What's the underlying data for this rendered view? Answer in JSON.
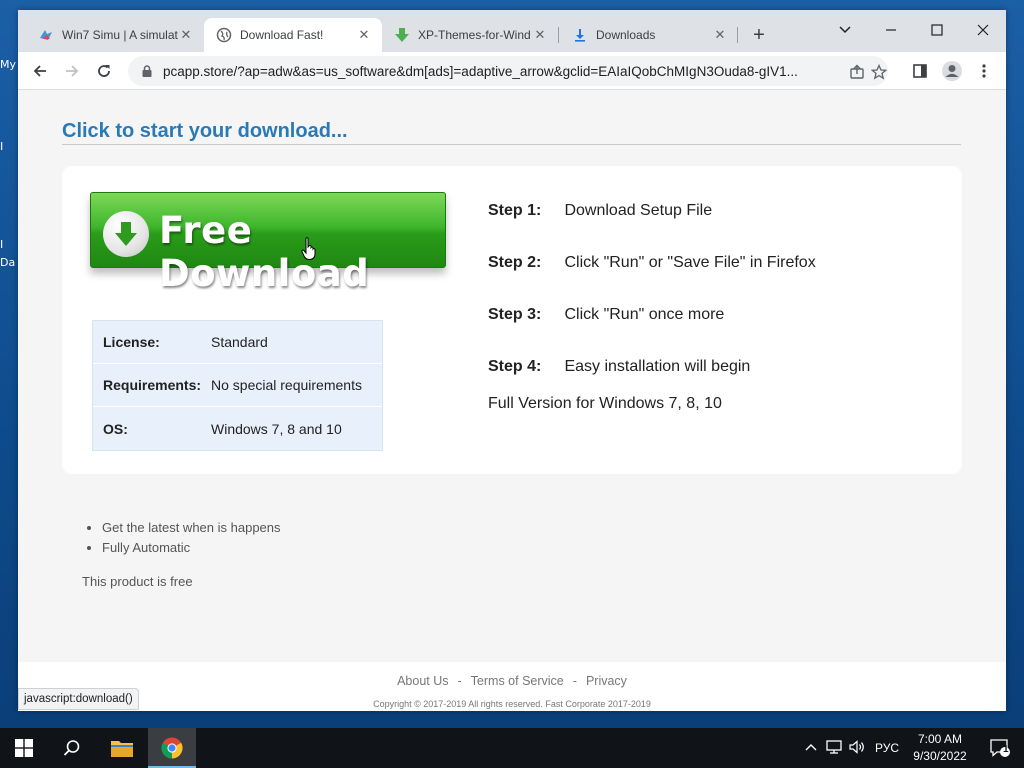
{
  "desktop": {
    "labels": [
      "My",
      "I",
      "I",
      "Da"
    ]
  },
  "tabs": [
    {
      "title": "Win7 Simu | A simulat",
      "icon": "win7-simu-icon",
      "active": false
    },
    {
      "title": "Download Fast!",
      "icon": "globe-icon",
      "active": true
    },
    {
      "title": "XP-Themes-for-Wind",
      "icon": "green-download-arrow-icon",
      "active": false
    },
    {
      "title": "Downloads",
      "icon": "download-icon",
      "active": false
    }
  ],
  "toolbar": {
    "url": "pcapp.store/?ap=adw&as=us_software&dm[ads]=adaptive_arrow&gclid=EAIaIQobChMIgN3Ouda8-gIV1..."
  },
  "page": {
    "headline": "Click to start your download...",
    "download_button_label": "Free Download",
    "info": [
      {
        "key": "License:",
        "value": "Standard"
      },
      {
        "key": "Requirements:",
        "value": "No special requirements"
      },
      {
        "key": "OS:",
        "value": "Windows 7, 8 and 10"
      }
    ],
    "steps": [
      {
        "label": "Step 1:",
        "text": "Download Setup File"
      },
      {
        "label": "Step 2:",
        "text": "Click \"Run\" or \"Save File\" in Firefox"
      },
      {
        "label": "Step 3:",
        "text": "Click \"Run\" once more"
      },
      {
        "label": "Step 4:",
        "text": "Easy installation will begin"
      }
    ],
    "full_version": "Full Version for Windows 7, 8, 10",
    "bullets": [
      "Get the latest when is happens",
      "Fully Automatic"
    ],
    "free_text": "This product is free"
  },
  "footer": {
    "links": [
      "About Us",
      "Terms of Service",
      "Privacy"
    ],
    "separator": "-",
    "copyright": "Copyright © 2017-2019 All rights reserved. Fast Corporate 2017-2019"
  },
  "status_bar": "javascript:download()",
  "taskbar": {
    "language": "РУС",
    "time": "7:00 AM",
    "date": "9/30/2022",
    "notification_count": "1"
  }
}
